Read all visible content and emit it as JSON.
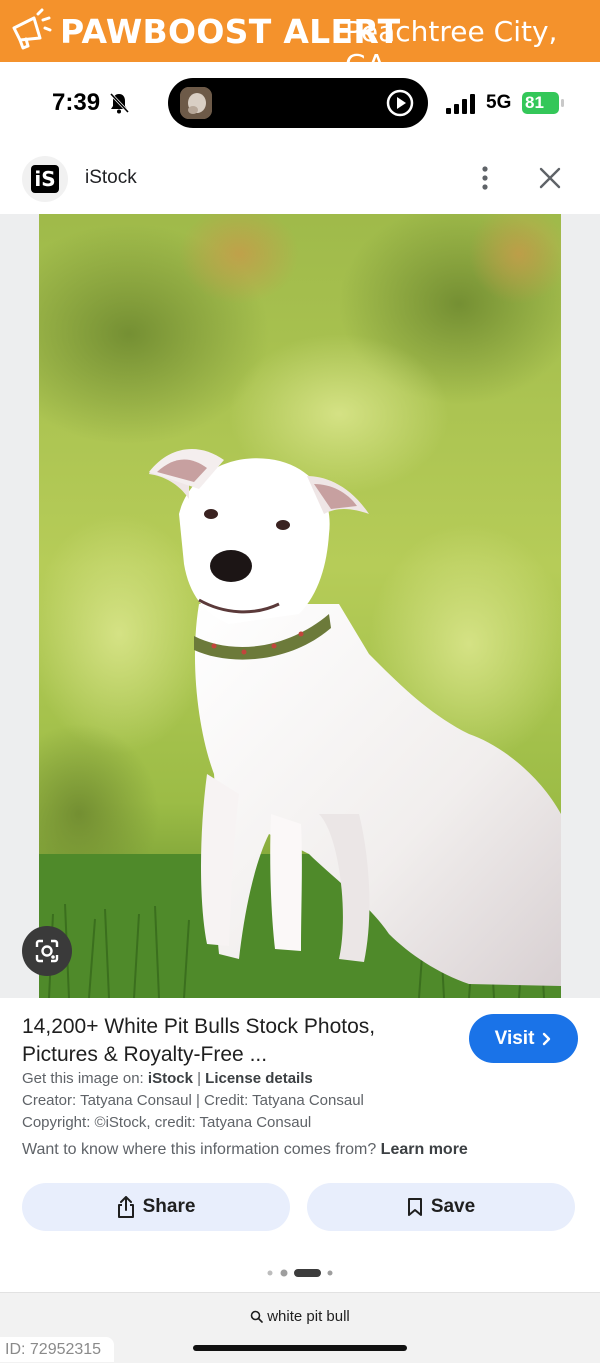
{
  "alert": {
    "brand": "PAWBOOST ALERT",
    "location": "Peachtree City, GA",
    "color": "#f4922c"
  },
  "status_bar": {
    "time": "7:39",
    "network": "5G",
    "battery": "81"
  },
  "site": {
    "logo": "iS",
    "name": "iStock"
  },
  "result": {
    "title": "14,200+ White Pit Bulls Stock Photos, Pictures & Royalty-Free ...",
    "visit_label": "Visit",
    "source_prefix": "Get this image on:",
    "source_name": "iStock",
    "separator": "|",
    "license": "License details",
    "creator": "Creator: Tatyana Consaul | Credit: Tatyana Consaul",
    "copyright": "Copyright: ©iStock, credit: Tatyana Consaul",
    "info_question": "Want to know where this information comes from?",
    "learn_more": "Learn more",
    "accent_color": "#1a73e8"
  },
  "actions": {
    "share_label": "Share",
    "save_label": "Save"
  },
  "bottom": {
    "search_query": "white pit bull",
    "id_tag": "ID: 72952315"
  },
  "icons": [
    "megaphone-icon",
    "bell-slash-icon",
    "play-icon",
    "signal-icon",
    "more-vert-icon",
    "close-icon",
    "lens-icon",
    "chevron-right-icon",
    "share-icon",
    "bookmark-icon",
    "search-icon"
  ]
}
